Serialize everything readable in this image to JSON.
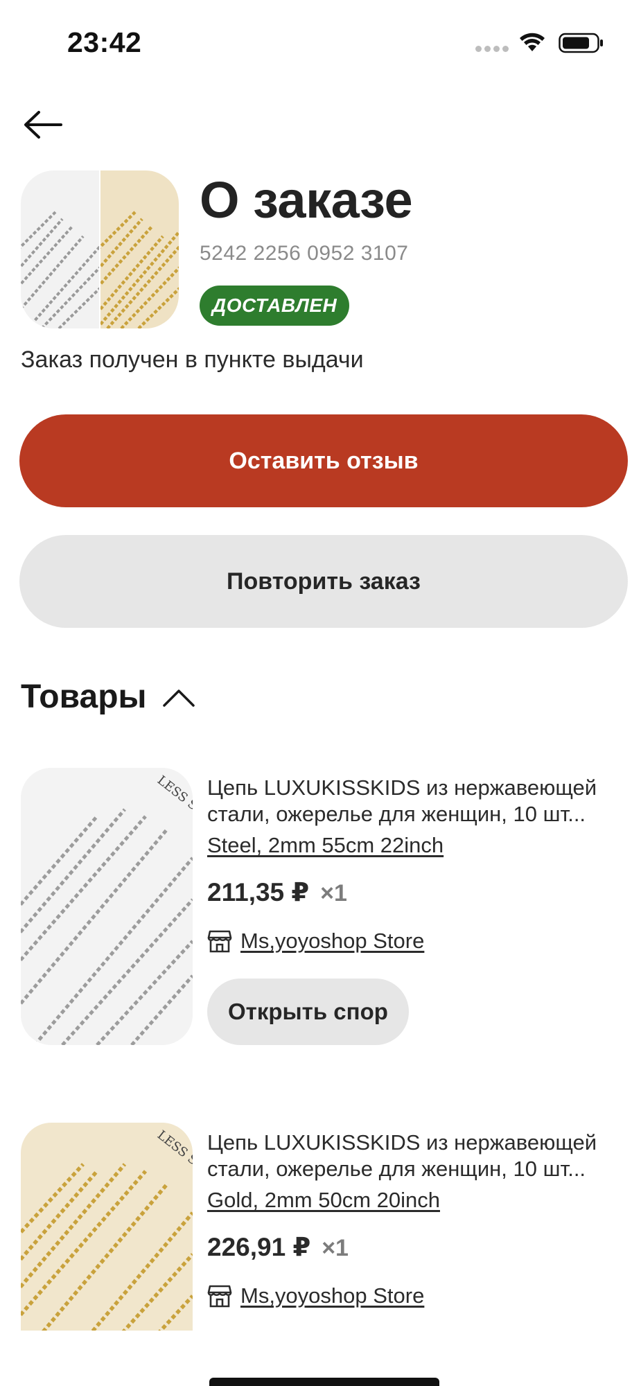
{
  "status_bar": {
    "time": "23:42",
    "icons": [
      "cellular-signal-icon",
      "wifi-icon",
      "battery-icon"
    ]
  },
  "header": {
    "back_icon": "arrow-left-icon",
    "title": "О заказе",
    "order_number": "5242 2256 0952 3107",
    "status_badge": "ДОСТАВЛЕН",
    "status_color": "#2e7d2e",
    "delivery_note": "Заказ получен в пункте выдачи"
  },
  "actions": {
    "leave_review": "Оставить отзыв",
    "repeat_order": "Повторить заказ",
    "accent_color": "#b93a22"
  },
  "products_section": {
    "title": "Товары",
    "toggle_icon": "chevron-up-icon",
    "items": [
      {
        "title": "Цепь LUXUKISSKIDS из нержавеющей стали, ожерелье для женщин, 10 шт...",
        "variant": "Steel, 2mm 55cm 22inch",
        "price": "211,35 ₽",
        "quantity": "×1",
        "store": "Ms,yoyoshop Store",
        "store_icon": "store-icon",
        "dispute_label": "Открыть спор",
        "image_tone": "silver"
      },
      {
        "title": "Цепь LUXUKISSKIDS из нержавеющей стали, ожерелье для женщин, 10 шт...",
        "variant": "Gold, 2mm 50cm 20inch",
        "price": "226,91 ₽",
        "quantity": "×1",
        "store": "Ms,yoyoshop Store",
        "store_icon": "store-icon",
        "image_tone": "gold"
      }
    ]
  }
}
